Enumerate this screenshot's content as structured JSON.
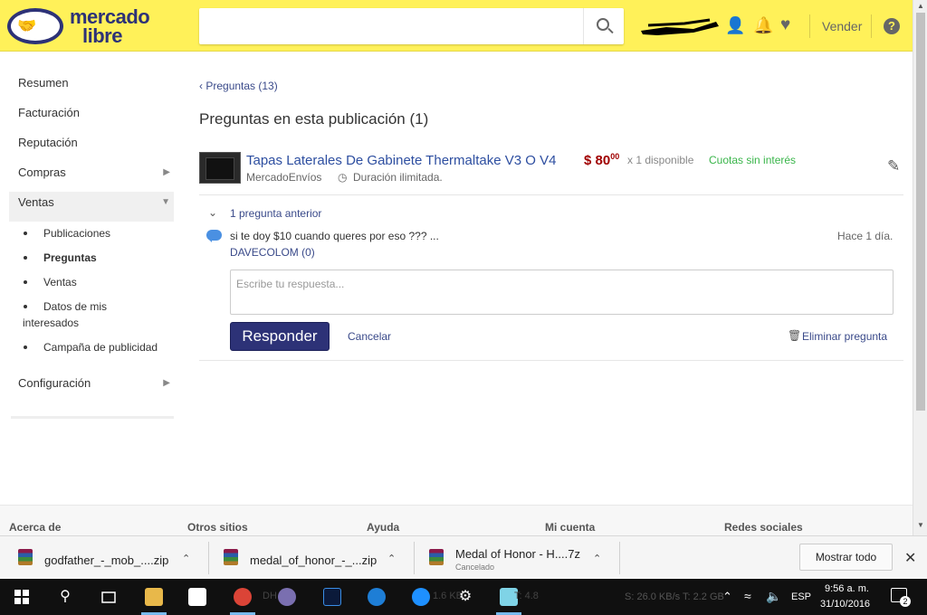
{
  "header": {
    "logo_line1": "mercado",
    "logo_line2": "libre",
    "search_placeholder": "",
    "vender_label": "Vender",
    "help_label": "?",
    "brand_color": "#fff159",
    "brand_dark": "#2d3277"
  },
  "sidebar": {
    "items": [
      {
        "label": "Resumen"
      },
      {
        "label": "Facturación"
      },
      {
        "label": "Reputación"
      },
      {
        "label": "Compras"
      },
      {
        "label": "Ventas"
      }
    ],
    "subitems": [
      {
        "label": "Publicaciones"
      },
      {
        "label": "Preguntas"
      },
      {
        "label": "Ventas"
      },
      {
        "label_line1": "Datos de mis",
        "label_line2": "interesados"
      },
      {
        "label": "Campaña de publicidad"
      }
    ],
    "config_label": "Configuración"
  },
  "main": {
    "back_link": "Preguntas (13)",
    "title": "Preguntas en esta publicación (1)",
    "item": {
      "title": "Tapas Laterales De Gabinete Thermaltake V3 O V4",
      "price_symbol": "$",
      "price_int": "80",
      "price_cents": "00",
      "quantity": "x 1 disponible",
      "installments": "Cuotas sin interés",
      "shipping": "MercadoEnvíos",
      "duration": "Duración ilimitada."
    },
    "previous_questions": "1 pregunta anterior",
    "question": {
      "text": "si te doy $10 cuando queres por eso ??? ...",
      "time": "Hace 1 día.",
      "user": "DAVECOLOM (0)"
    },
    "answer_placeholder": "Escribe tu respuesta...",
    "respond_label": "Responder",
    "cancel_label": "Cancelar",
    "delete_label": "Eliminar pregunta"
  },
  "footer": {
    "columns": [
      "Acerca de",
      "Otros sitios",
      "Ayuda",
      "Mi cuenta",
      "Redes sociales"
    ]
  },
  "downloads": {
    "items": [
      {
        "name": "godfather_-_mob_....zip",
        "status": ""
      },
      {
        "name": "medal_of_honor_-_...zip",
        "status": ""
      },
      {
        "name": "Medal of Honor - H....7z",
        "status": "Cancelado"
      }
    ],
    "show_all_label": "Mostrar todo"
  },
  "taskbar": {
    "faint_labels": [
      "DH",
      "1.6 KB/",
      "T: 4.8"
    ],
    "net_stats": "S: 26.0 KB/s T: 2.2 GB",
    "language": "ESP",
    "time": "9:56 a. m.",
    "date": "31/10/2016",
    "notification_count": "2"
  }
}
